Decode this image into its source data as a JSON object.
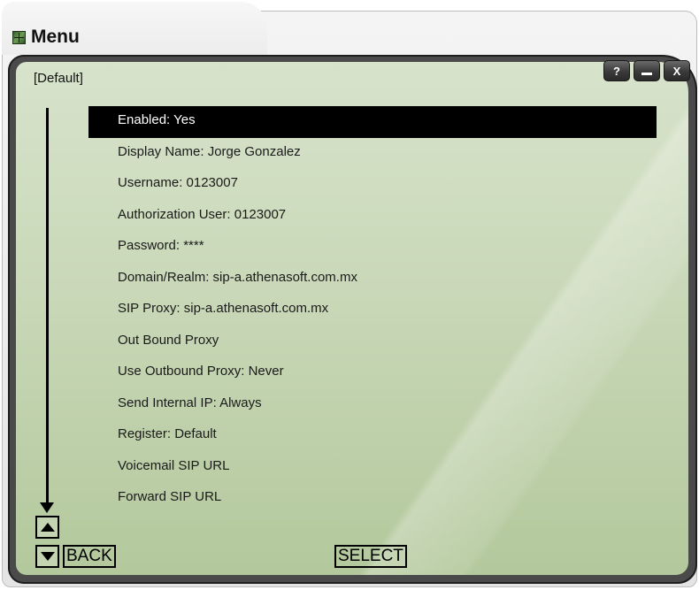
{
  "window": {
    "title": "Menu",
    "app_icon": "app-icon",
    "profile_label": "[Default]",
    "controls": {
      "help_label": "?",
      "close_label": "X",
      "minimize_icon": "minimize-icon"
    }
  },
  "menu": {
    "items": [
      {
        "label": "Enabled: Yes"
      },
      {
        "label": "Display Name: Jorge Gonzalez"
      },
      {
        "label": "Username: 0123007"
      },
      {
        "label": "Authorization User: 0123007"
      },
      {
        "label": "Password: ****"
      },
      {
        "label": "Domain/Realm: sip-a.athenasoft.com.mx"
      },
      {
        "label": "SIP Proxy: sip-a.athenasoft.com.mx"
      },
      {
        "label": "Out Bound Proxy"
      },
      {
        "label": "Use Outbound Proxy: Never"
      },
      {
        "label": "Send Internal IP: Always"
      },
      {
        "label": "Register: Default"
      },
      {
        "label": "Voicemail SIP URL"
      },
      {
        "label": "Forward SIP URL"
      }
    ],
    "selected_index": 0
  },
  "softkeys": {
    "back_label": "BACK",
    "select_label": "SELECT",
    "up_icon": "arrow-up-icon",
    "down_icon": "arrow-down-icon"
  },
  "colors": {
    "panel_green": "#c9d8b8",
    "selection_bg": "#000000",
    "selection_text": "#ffffff"
  }
}
